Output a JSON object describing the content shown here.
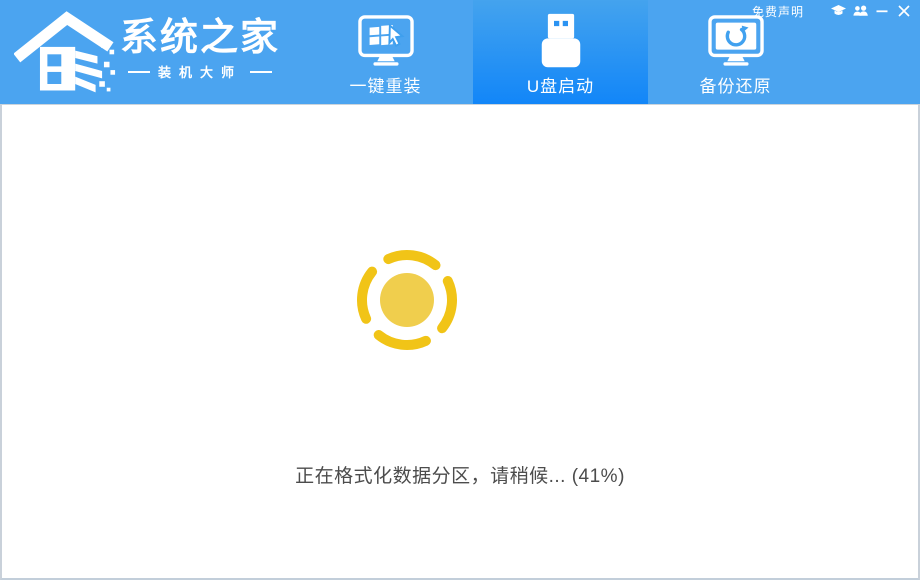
{
  "titlebar": {
    "disclaimer_label": "免费声明",
    "icons": [
      "graduation-cap-icon",
      "users-icon",
      "minimize-icon",
      "close-icon"
    ]
  },
  "brand": {
    "title": "系统之家",
    "subtitle": "装机大师",
    "logo_icon": "house-pixel-icon"
  },
  "tabs": [
    {
      "id": "onekey-reinstall",
      "label": "一键重装",
      "icon": "monitor-windows-cursor-icon",
      "active": false
    },
    {
      "id": "usb-boot",
      "label": "U盘启动",
      "icon": "usb-drive-icon",
      "active": true
    },
    {
      "id": "backup-restore",
      "label": "备份还原",
      "icon": "monitor-restore-icon",
      "active": false
    }
  ],
  "main": {
    "status_text": "正在格式化数据分区，请稍候... (41%)",
    "progress_percent": 41,
    "spinner": "yellow-ring-spinner"
  },
  "colors": {
    "header_bg": "#4BA4F0",
    "active_tab_gradient_top": "#44A3EE",
    "active_tab_gradient_bottom": "#1286F8",
    "spinner_arc": "#F1C417",
    "spinner_center": "#F0CE4D",
    "status_text": "#4C4C4C",
    "content_border": "#C9D1DA"
  }
}
